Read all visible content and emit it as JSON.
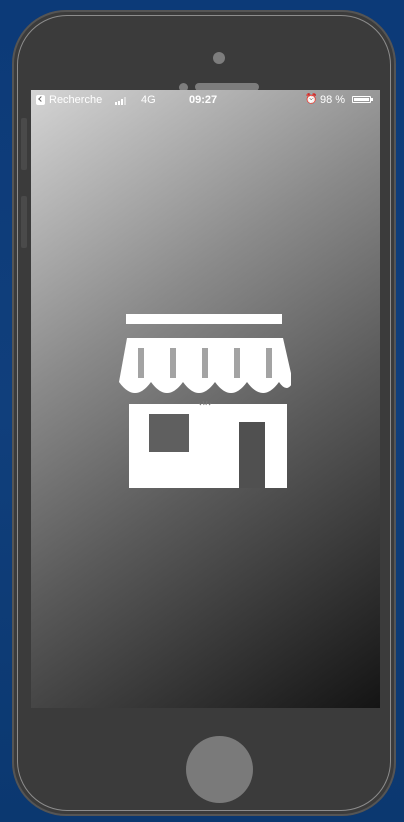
{
  "status_bar": {
    "back_label": "Recherche",
    "network": "4G",
    "time": "09:27",
    "alarm_icon": "alarm-clock-icon",
    "battery_text": "98 %",
    "battery_level": 0.98,
    "signal_bars": 3
  },
  "splash": {
    "icon": "storefront-icon"
  },
  "colors": {
    "background": "#0f3f7a",
    "phone_body": "#3b3b3b",
    "icon": "#ffffff"
  }
}
